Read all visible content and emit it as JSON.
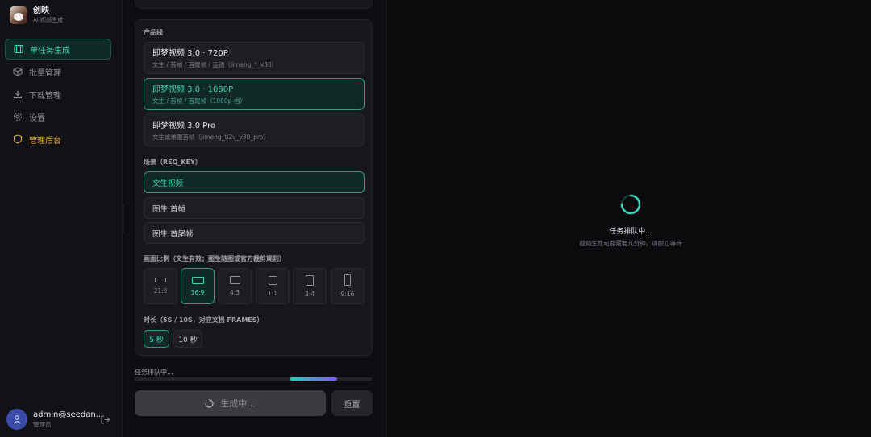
{
  "brand": {
    "name": "创映",
    "subtitle": "AI 视频生成"
  },
  "nav": [
    {
      "label": "单任务生成",
      "icon": "film-icon",
      "active": true
    },
    {
      "label": "批量管理",
      "icon": "cube-icon"
    },
    {
      "label": "下载管理",
      "icon": "download-icon"
    },
    {
      "label": "设置",
      "icon": "gear-icon"
    },
    {
      "label": "管理后台",
      "icon": "shield-icon"
    }
  ],
  "user": {
    "name": "admin@seedan...",
    "role": "管理员"
  },
  "product": {
    "label": "产品线",
    "items": [
      {
        "name": "即梦视频 3.0 · 720P",
        "desc": "文生 / 首帧 / 首尾帧 / 运镜（jimeng_*_v30）"
      },
      {
        "name": "即梦视频 3.0 · 1080P",
        "desc": "文生 / 首帧 / 首尾帧（1080p 档）",
        "selected": true
      },
      {
        "name": "即梦视频 3.0 Pro",
        "desc": "文生或单图首帧（jimeng_ti2v_v30_pro）"
      }
    ]
  },
  "scene": {
    "label": "场景（REQ_KEY）",
    "items": [
      {
        "label": "文生视频",
        "selected": true
      },
      {
        "label": "图生·首帧"
      },
      {
        "label": "图生·首尾帧"
      }
    ]
  },
  "ratio": {
    "label": "画面比例（文生有效；图生随图或官方裁剪规则）",
    "items": [
      "21:9",
      "16:9",
      "4:3",
      "1:1",
      "3:4",
      "9:16"
    ],
    "selected": "16:9"
  },
  "duration": {
    "label": "时长（5S / 10S，对应文档 FRAMES）",
    "items": [
      "5 秒",
      "10 秒"
    ],
    "selected": "5 秒"
  },
  "progress": {
    "status": "任务排队中...",
    "value": 0.85
  },
  "actions": {
    "generate": "生成中...",
    "reset": "重置"
  },
  "preview": {
    "title": "任务排队中...",
    "subtitle": "视频生成可能需要几分钟，请耐心等待"
  },
  "colors": {
    "accent": "#3fd3b8",
    "admin": "#e4b23a",
    "progress_start": "#2ec9c0",
    "progress_end": "#7a5cf0"
  }
}
